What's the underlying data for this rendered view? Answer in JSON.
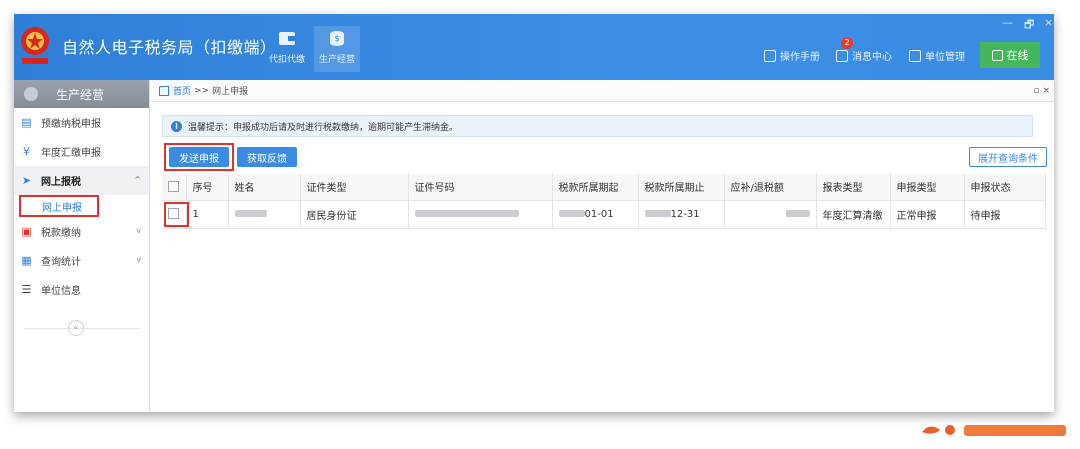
{
  "header": {
    "app_title": "自然人电子税务局（扣缴端）",
    "nav": [
      {
        "label": "代扣代缴",
        "icon": "wallet-icon",
        "active": false
      },
      {
        "label": "生产经营",
        "icon": "coins-icon",
        "active": true
      }
    ],
    "links": {
      "manual": "操作手册",
      "messages": "消息中心",
      "message_count": "2",
      "unit_manage": "单位管理"
    },
    "online_label": "在线",
    "window_controls": {
      "minimize": "—",
      "maximize": "🗗",
      "close": "×"
    }
  },
  "sidebar": {
    "section_title": "生产经营",
    "items": [
      {
        "label": "预缴纳税申报",
        "icon": "document-icon"
      },
      {
        "label": "年度汇缴申报",
        "icon": "yen-circle-icon"
      },
      {
        "label": "网上报税",
        "icon": "send-icon",
        "expanded": true,
        "chevron": "^"
      },
      {
        "label": "税款缴纳",
        "icon": "payment-icon",
        "chevron": "v"
      },
      {
        "label": "查询统计",
        "icon": "report-icon",
        "chevron": "v"
      },
      {
        "label": "单位信息",
        "icon": "list-icon"
      }
    ],
    "sub_item": "网上申报",
    "collapse": "«"
  },
  "main": {
    "breadcrumb": {
      "home": "首页",
      "sep": ">>",
      "current": "网上申报"
    },
    "tab_controls": "▫ ×",
    "notice": "温馨提示：申报成功后请及时进行税款缴纳，逾期可能产生滞纳金。",
    "buttons": {
      "send": "发送申报",
      "feedback": "获取反馈",
      "expand_query": "展开查询条件"
    },
    "table": {
      "headers": [
        "序号",
        "姓名",
        "证件类型",
        "证件号码",
        "税款所属期起",
        "税款所属期止",
        "应补/退税额",
        "报表类型",
        "申报类型",
        "申报状态"
      ],
      "rows": [
        {
          "index": "1",
          "id_type": "居民身份证",
          "period_start": "01-01",
          "period_end": "12-31",
          "report_type": "年度汇算清缴",
          "declare_type": "正常申报",
          "status": "待申报"
        }
      ]
    }
  },
  "colors": {
    "brand": "#3a8be2",
    "highlight": "#e0312a",
    "online": "#44b65b"
  }
}
